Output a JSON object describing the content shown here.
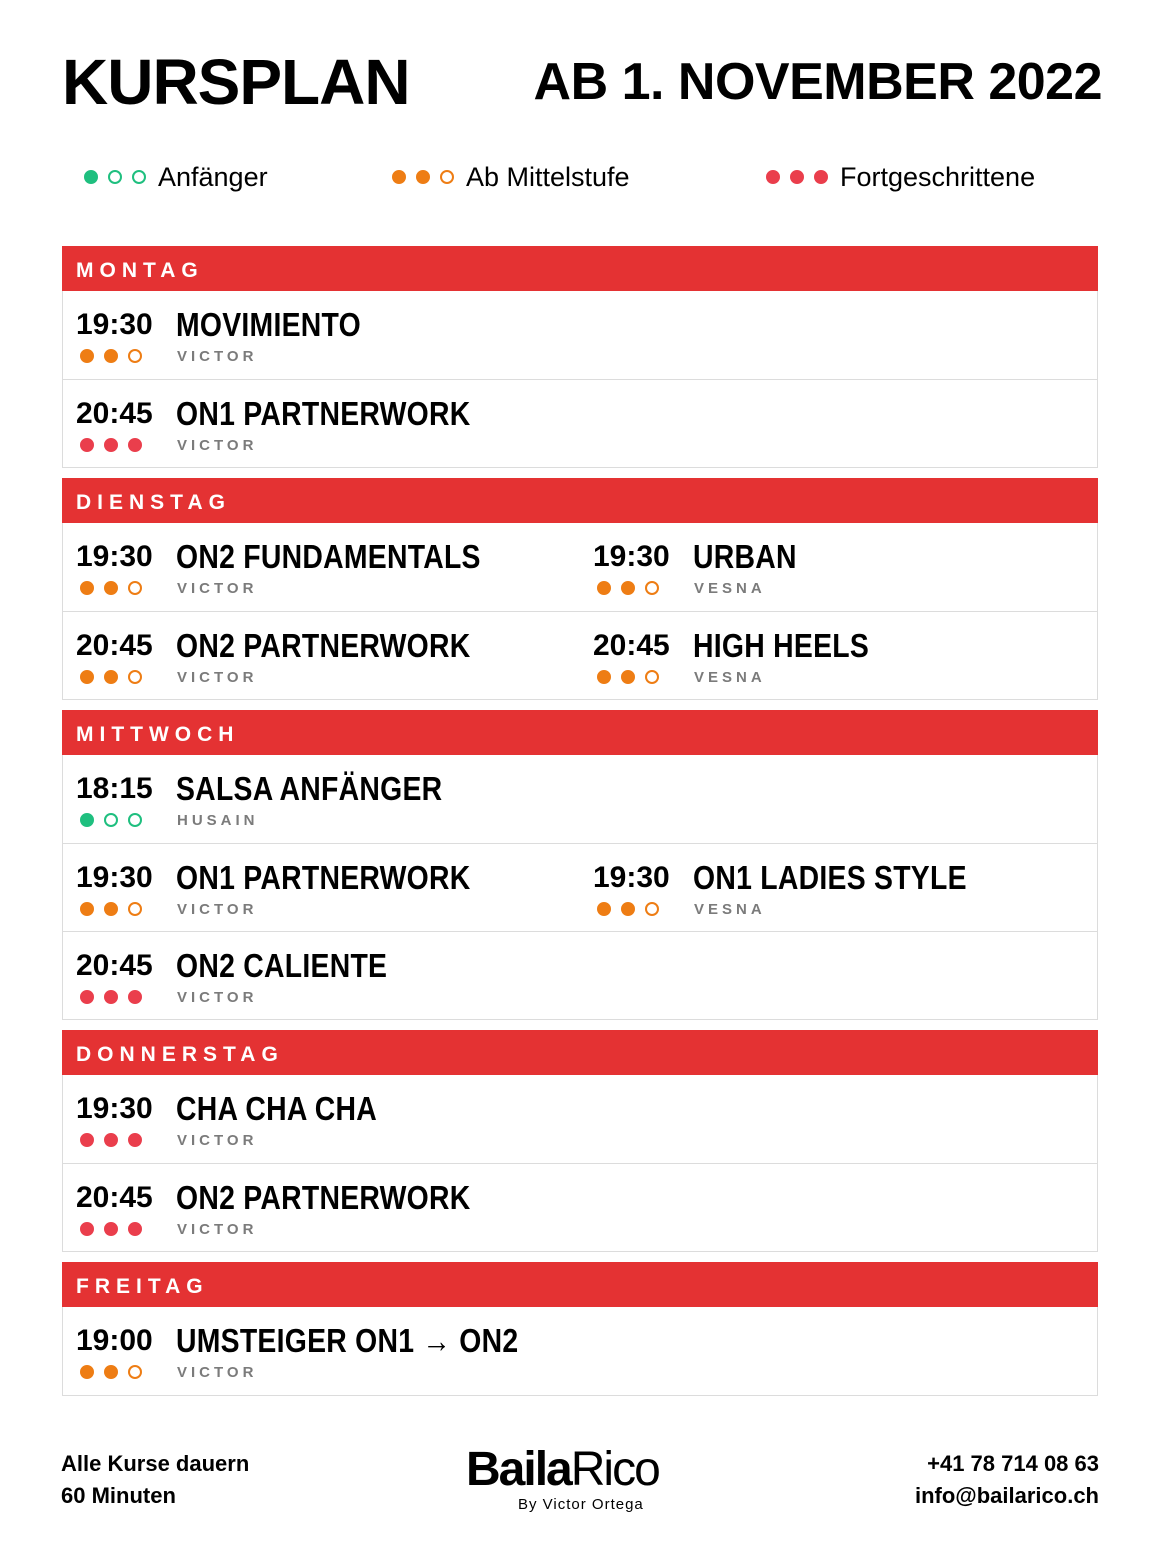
{
  "header": {
    "title": "KURSPLAN",
    "date": "AB 1. NOVEMBER 2022"
  },
  "legend": [
    {
      "label": "Anfänger",
      "filled": 1,
      "color": "#1fbf7f"
    },
    {
      "label": "Ab Mittelstufe",
      "filled": 2,
      "color": "#ee7d14"
    },
    {
      "label": "Fortgeschrittene",
      "filled": 3,
      "color": "#ea3e4c"
    }
  ],
  "days": [
    {
      "name": "MONTAG",
      "rows": [
        [
          {
            "time": "19:30",
            "course": "MOVIMIENTO",
            "teacher": "VICTOR",
            "level": 2
          }
        ],
        [
          {
            "time": "20:45",
            "course": "ON1 PARTNERWORK",
            "teacher": "VICTOR",
            "level": 3
          }
        ]
      ]
    },
    {
      "name": "DIENSTAG",
      "rows": [
        [
          {
            "time": "19:30",
            "course": "ON2 FUNDAMENTALS",
            "teacher": "VICTOR",
            "level": 2
          },
          {
            "time": "19:30",
            "course": "URBAN",
            "teacher": "VESNA",
            "level": 2
          }
        ],
        [
          {
            "time": "20:45",
            "course": "ON2 PARTNERWORK",
            "teacher": "VICTOR",
            "level": 2
          },
          {
            "time": "20:45",
            "course": "HIGH HEELS",
            "teacher": "VESNA",
            "level": 2
          }
        ]
      ]
    },
    {
      "name": "MITTWOCH",
      "rows": [
        [
          {
            "time": "18:15",
            "course": "SALSA ANFÄNGER",
            "teacher": "HUSAIN",
            "level": 1
          }
        ],
        [
          {
            "time": "19:30",
            "course": "ON1 PARTNERWORK",
            "teacher": "VICTOR",
            "level": 2
          },
          {
            "time": "19:30",
            "course": "ON1 LADIES STYLE",
            "teacher": "VESNA",
            "level": 2
          }
        ],
        [
          {
            "time": "20:45",
            "course": "ON2 CALIENTE",
            "teacher": "VICTOR",
            "level": 3
          }
        ]
      ]
    },
    {
      "name": "DONNERSTAG",
      "rows": [
        [
          {
            "time": "19:30",
            "course": "CHA CHA CHA",
            "teacher": "VICTOR",
            "level": 3
          }
        ],
        [
          {
            "time": "20:45",
            "course": "ON2 PARTNERWORK",
            "teacher": "VICTOR",
            "level": 3
          }
        ]
      ]
    },
    {
      "name": "FREITAG",
      "rows": [
        [
          {
            "time": "19:00",
            "course": "UMSTEIGER ON1 → ON2",
            "teacher": "VICTOR",
            "level": 2
          }
        ]
      ]
    }
  ],
  "footer": {
    "duration_line1": "Alle Kurse dauern",
    "duration_line2": "60 Minuten",
    "phone": "+41 78 714 08 63",
    "email": "info@bailarico.ch",
    "logo_bold": "Baila",
    "logo_light": "Rico",
    "logo_sub": "By  Victor  Ortega"
  }
}
